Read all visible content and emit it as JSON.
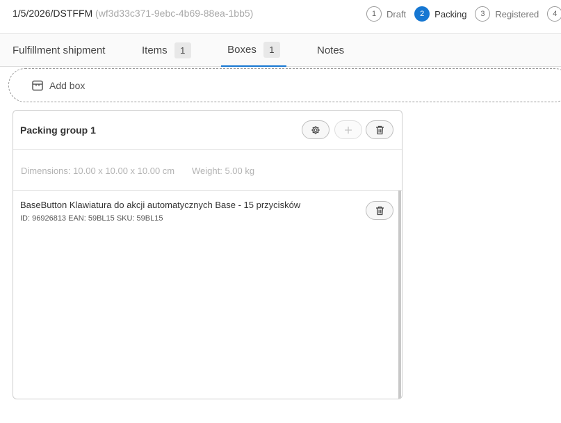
{
  "header": {
    "doc_number": "1/5/2026/DSTFFM",
    "doc_uuid": "(wf3d33c371-9ebc-4b69-88ea-1bb5)"
  },
  "steps": [
    {
      "num": "1",
      "label": "Draft",
      "active": false
    },
    {
      "num": "2",
      "label": "Packing",
      "active": true
    },
    {
      "num": "3",
      "label": "Registered",
      "active": false
    },
    {
      "num": "4",
      "label": "",
      "active": false
    }
  ],
  "tabs": {
    "fulfillment": "Fulfillment shipment",
    "items": {
      "label": "Items",
      "count": "1"
    },
    "boxes": {
      "label": "Boxes",
      "count": "1"
    },
    "notes": "Notes",
    "active": "boxes"
  },
  "add_box": {
    "label": "Add box",
    "icon": "package-icon"
  },
  "packing_group": {
    "title": "Packing group 1",
    "dimensions": "Dimensions: 10.00 x 10.00 x 10.00 cm",
    "weight": "Weight: 5.00 kg",
    "actions": [
      "gear-icon",
      "plus-icon",
      "trash-icon"
    ],
    "items": [
      {
        "name": "BaseButton Klawiatura do akcji automatycznych Base - 15 przycisków",
        "meta": "ID: 96926813 EAN: 59BL15 SKU: 59BL15"
      }
    ]
  },
  "colors": {
    "accent": "#1677d2",
    "muted": "#b3b3b3"
  }
}
